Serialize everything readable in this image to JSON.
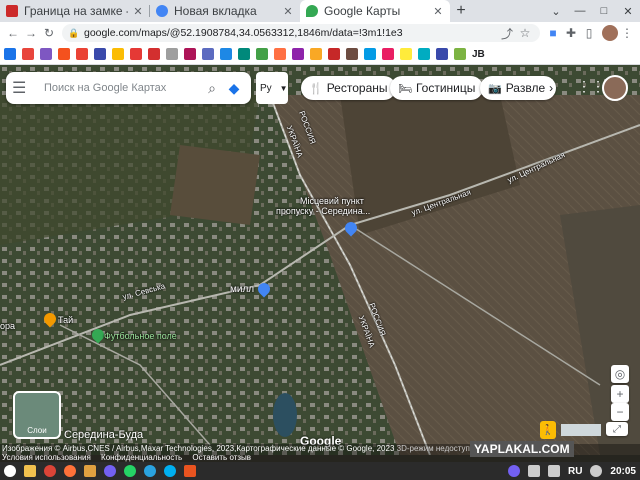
{
  "tabs": [
    {
      "title": "Граница на замке - ЯПЛА",
      "favicon_color": "#cc2a2a",
      "active": false
    },
    {
      "title": "Новая вкладка",
      "favicon_color": "#4285f4",
      "active": false
    },
    {
      "title": "Google Карты",
      "favicon_color": "#34a853",
      "active": true
    }
  ],
  "address": {
    "url": "google.com/maps/@52.1908784,34.0563312,1846m/data=!3m1!1e3"
  },
  "bookmarks": {
    "last_text": "JB",
    "colors": [
      "#1a73e8",
      "#e8453c",
      "#7e57c2",
      "#f4511e",
      "#ea4335",
      "#3949ab",
      "#fbbc04",
      "#e53935",
      "#d32f2f",
      "#9e9e9e",
      "#ad1457",
      "#5c6bc0",
      "#1e88e5",
      "#00897b",
      "#43a047",
      "#ff7043",
      "#8e24aa",
      "#f9a825",
      "#c62828",
      "#6d4c41",
      "#039be5",
      "#e91e63",
      "#ffeb3b",
      "#00acc1",
      "#3949ab",
      "#7cb342"
    ]
  },
  "search": {
    "placeholder": "Поиск на Google Картах",
    "lang": "Ру"
  },
  "chips": [
    {
      "icon": "🍴",
      "label": "Рестораны"
    },
    {
      "icon": "🛏",
      "label": "Гостиницы"
    },
    {
      "icon": "📷",
      "label": "Развле"
    }
  ],
  "map_labels": {
    "border_ru_top": "РОССИЯ",
    "border_ua_top": "УКРАЇНА",
    "border_ru_bottom": "РОССИЯ",
    "border_ua_bottom": "УКРАЇНА",
    "checkpoint": "Місцевий пункт",
    "checkpoint2": "пропуску - Середина...",
    "street_central": "ул. Центральная",
    "street_central2": "ул. Центральная",
    "street_sevska": "ул. Севська",
    "mill": "милл",
    "tai": "Тай",
    "ora": "ора",
    "football": "Футбольное поле",
    "place": "Середина-Буда",
    "google": "Google",
    "layers": "Слои"
  },
  "attribution": {
    "line1": "Изображения © Airbus,CNES / Airbus,Maxar Technologies, 2023,Картографические данные © Google, 2023",
    "line1b": "3D-режим недоступ...",
    "links": [
      "Условия использования",
      "Конфиденциальность",
      "Оставить отзыв"
    ]
  },
  "watermark": "YAPLAKAL.COM",
  "taskbar": {
    "lang": "RU",
    "time": "20:05"
  }
}
